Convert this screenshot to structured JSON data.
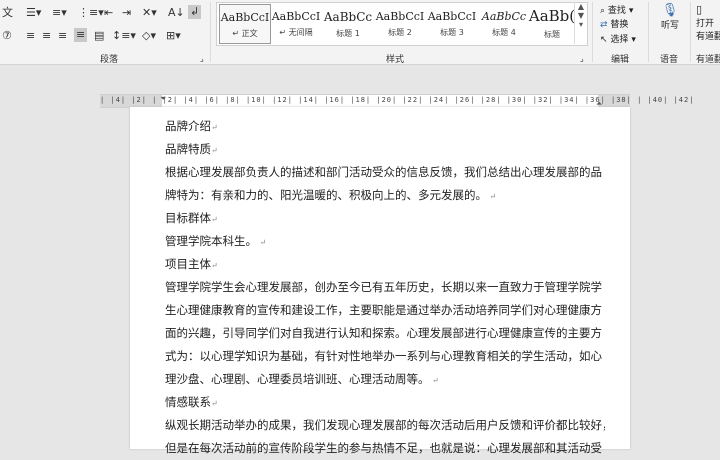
{
  "ribbon": {
    "groups": {
      "paragraph": "段落",
      "styles": "样式",
      "editing": "编辑",
      "voice": "语音",
      "reuse": "有道翻"
    },
    "styles": [
      {
        "sample": "AaBbCcI",
        "name": "↵ 正文"
      },
      {
        "sample": "AaBbCcI",
        "name": "↵ 无间隔"
      },
      {
        "sample": "AaBbCc",
        "name": "标题 1"
      },
      {
        "sample": "AaBbCcI",
        "name": "标题 2"
      },
      {
        "sample": "AaBbCcI",
        "name": "标题 3"
      },
      {
        "sample": "AaBbCc",
        "name": "标题 4"
      },
      {
        "sample": "AaBb(",
        "name": "标题"
      }
    ],
    "editing": {
      "find": "查找",
      "replace": "替换",
      "select": "选择"
    },
    "dictate": "听写",
    "open": "打开",
    "open2": "有道翻"
  },
  "ruler": {
    "ticks": "|  |4|  |2|  |  |2|  |4|  |6|  |8|  |10|  |12|  |14|  |16|  |18|  |20|  |22|  |24|  |26|  |28|  |30|  |32|  |34|  |36|  |38|  |  |40|  |42|"
  },
  "document": {
    "paragraphs": [
      "品牌介绍",
      "品牌特质",
      "根据心理发展部负责人的描述和部门活动受众的信息反馈，我们总结出心理发展部的品",
      "牌特为：有亲和力的、阳光温暖的、积极向上的、多元发展的。",
      "目标群体",
      "管理学院本科生。",
      "项目主体",
      "管理学院学生会心理发展部，创办至今已有五年历史，长期以来一直致力于管理学院学",
      "生心理健康教育的宣传和建设工作，主要职能是通过举办活动培养同学们对心理健康方",
      "面的兴趣，引导同学们对自我进行认知和探索。心理发展部进行心理健康宣传的主要方",
      "式为：以心理学知识为基础，有针对性地举办一系列与心理教育相关的学生活动，如心",
      "理沙盘、心理剧、心理委员培训班、心理活动周等。",
      "情感联系",
      "纵观长期活动举办的成果，我们发现心理发展部的每次活动后用户反馈和评价都比较好，",
      "但是在每次活动前的宣传阶段学生的参与热情不足，也就是说：心理发展部和其活动受"
    ]
  }
}
